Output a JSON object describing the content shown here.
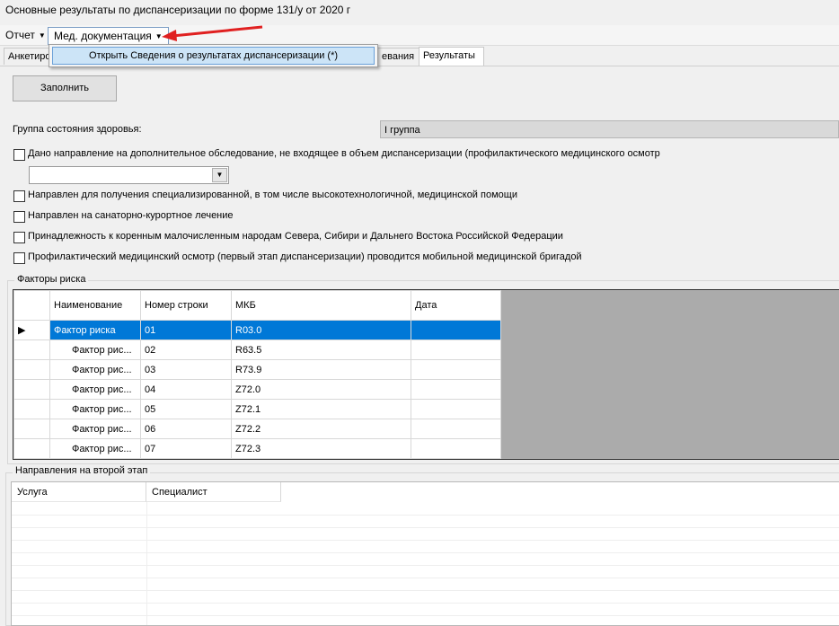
{
  "window": {
    "title": "Основные результаты по диспансеризации по форме 131/у от 2020 г"
  },
  "menu": {
    "report": "Отчет",
    "meddocs": "Мед. документация",
    "dropdown_item": "Открыть Сведения о результатах диспансеризации (*)"
  },
  "tabs": [
    {
      "label": "Анкетиро"
    },
    {
      "label": "евания"
    },
    {
      "label": "Результаты"
    }
  ],
  "fill_button": "Заполнить",
  "health_group": {
    "label": "Группа состояния здоровья:",
    "value": "I группа"
  },
  "checkboxes": [
    {
      "label": "Дано направление на дополнительное обследование, не входящее в объем диспансеризации (профилактического медицинского осмотр",
      "checked": false
    },
    {
      "label": "Направлен для получения специализированной, в том числе высокотехнологичной, медицинской помощи",
      "checked": false
    },
    {
      "label": "Направлен на санаторно-курортное лечение",
      "checked": false
    },
    {
      "label": "Принадлежность к коренным малочисленным народам Севера, Сибири и Дальнего Востока Российской Федерации",
      "checked": false
    },
    {
      "label": "Профилактический медицинский осмотр (первый этап диспансеризации) проводится мобильной медицинской бригадой",
      "checked": false
    }
  ],
  "risk_factors": {
    "title": "Факторы риска",
    "headers": {
      "name": "Наименование",
      "line_no": "Номер строки",
      "mkb": "МКБ",
      "date": "Дата"
    },
    "rows": [
      {
        "name": "Фактор риска",
        "line": "01",
        "mkb": "R03.0",
        "date": ""
      },
      {
        "name": "Фактор рис...",
        "line": "02",
        "mkb": "R63.5",
        "date": ""
      },
      {
        "name": "Фактор рис...",
        "line": "03",
        "mkb": "R73.9",
        "date": ""
      },
      {
        "name": "Фактор рис...",
        "line": "04",
        "mkb": "Z72.0",
        "date": ""
      },
      {
        "name": "Фактор рис...",
        "line": "05",
        "mkb": "Z72.1",
        "date": ""
      },
      {
        "name": "Фактор рис...",
        "line": "06",
        "mkb": "Z72.2",
        "date": ""
      },
      {
        "name": "Фактор рис...",
        "line": "07",
        "mkb": "Z72.3",
        "date": ""
      }
    ]
  },
  "second_stage": {
    "title": "Направления на второй этап",
    "headers": {
      "service": "Услуга",
      "specialist": "Специалист"
    }
  }
}
